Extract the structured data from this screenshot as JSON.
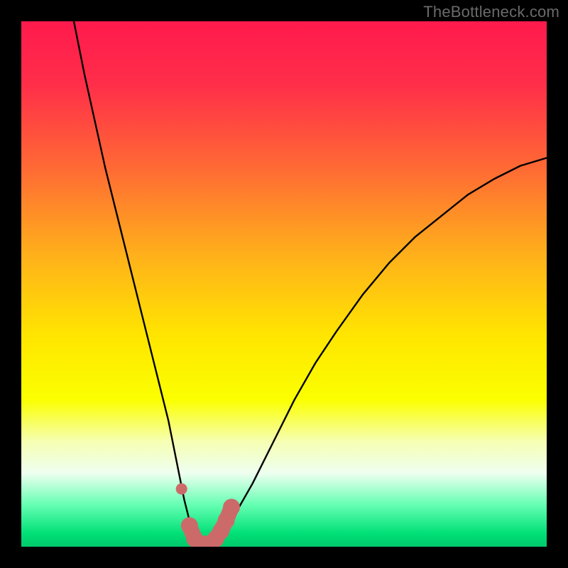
{
  "watermark": "TheBottleneck.com",
  "colors": {
    "frame": "#000000",
    "watermark": "#6a6a6a",
    "gradient_stops": [
      {
        "offset": 0.0,
        "color": "#ff1a4d"
      },
      {
        "offset": 0.12,
        "color": "#ff2e49"
      },
      {
        "offset": 0.28,
        "color": "#ff6a34"
      },
      {
        "offset": 0.45,
        "color": "#ffb21a"
      },
      {
        "offset": 0.6,
        "color": "#ffe600"
      },
      {
        "offset": 0.72,
        "color": "#fbff00"
      },
      {
        "offset": 0.8,
        "color": "#f6ffb3"
      },
      {
        "offset": 0.86,
        "color": "#eefff0"
      },
      {
        "offset": 0.92,
        "color": "#66ffb3"
      },
      {
        "offset": 0.975,
        "color": "#00e077"
      },
      {
        "offset": 1.0,
        "color": "#00c96b"
      }
    ],
    "curve": "#000000",
    "highlight": "#cc6a6a"
  },
  "chart_data": {
    "type": "line",
    "title": "",
    "xlabel": "",
    "ylabel": "",
    "xlim": [
      0,
      100
    ],
    "ylim": [
      0,
      100
    ],
    "y_axis_inverted_visually": true,
    "grid": false,
    "series": [
      {
        "name": "bottleneck-curve",
        "x": [
          10,
          12,
          14,
          16,
          18,
          20,
          22,
          24,
          26,
          28,
          30,
          31,
          32,
          33,
          34,
          35,
          36,
          38,
          40,
          44,
          48,
          52,
          56,
          60,
          65,
          70,
          75,
          80,
          85,
          90,
          95,
          100
        ],
        "y": [
          100,
          90,
          81,
          72,
          64,
          56,
          48,
          40,
          32,
          24,
          14,
          9,
          5,
          2,
          0,
          0,
          0,
          2,
          5,
          12,
          20,
          28,
          35,
          41,
          48,
          54,
          59,
          63,
          67,
          70,
          72.5,
          74
        ]
      }
    ],
    "highlight_points": {
      "name": "optimal-range",
      "x": [
        30.5,
        32,
        33,
        34,
        35,
        36,
        37,
        38,
        39,
        40
      ],
      "y": [
        11,
        4,
        1.5,
        0.5,
        0.5,
        0.5,
        1.5,
        3,
        5,
        7.5
      ]
    }
  }
}
